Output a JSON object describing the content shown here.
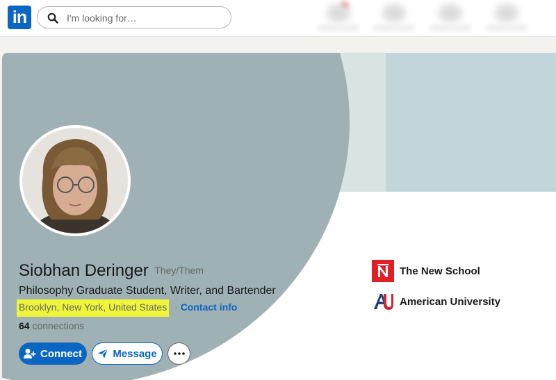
{
  "nav": {
    "logo_text": "in",
    "search_placeholder": "I'm looking for…"
  },
  "profile": {
    "name": "Siobhan Deringer",
    "pronouns": "They/Them",
    "headline": "Philosophy Graduate Student, Writer, and Bartender",
    "location": "Brooklyn, New York, United States",
    "separator": "·",
    "contact_info_label": "Contact info",
    "connections_count": "64",
    "connections_label": "connections"
  },
  "actions": {
    "connect_label": "Connect",
    "message_label": "Message",
    "more_label": "•••"
  },
  "education": [
    {
      "name": "The New School",
      "logo": "new-school-logo"
    },
    {
      "name": "American University",
      "logo": "american-university-logo"
    }
  ],
  "colors": {
    "brand": "#0a66c2",
    "highlight": "#f0f43a",
    "banner_light": "#c2d5da",
    "banner_dark": "#9fb1b5"
  }
}
